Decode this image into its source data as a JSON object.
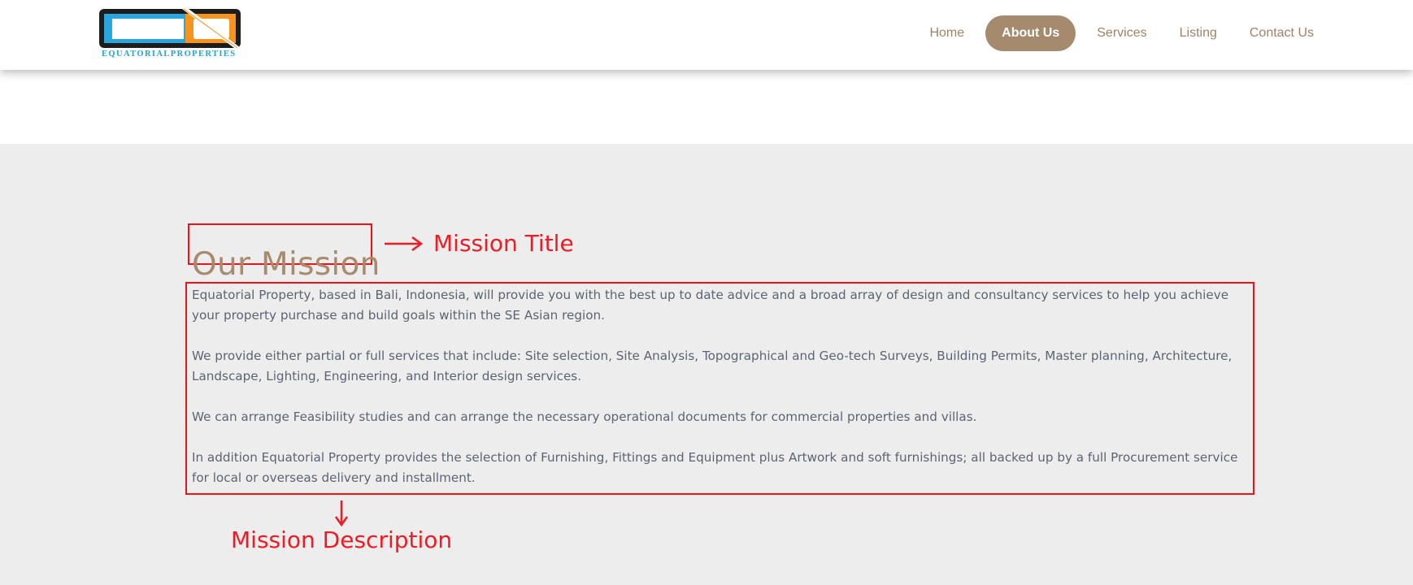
{
  "header": {
    "logo_text": "EQUATORIALPROPERTIES",
    "nav": [
      {
        "label": "Home"
      },
      {
        "label": "About Us"
      },
      {
        "label": "Services"
      },
      {
        "label": "Listing"
      },
      {
        "label": "Contact Us"
      }
    ],
    "active_nav": "About Us"
  },
  "mission": {
    "title": "Our Mission",
    "paragraphs": [
      "Equatorial Property, based in Bali, Indonesia, will provide you with the best up to date advice and a broad array of design and consultancy services to help you achieve your property purchase and build goals within the SE Asian region.",
      "We provide either partial or full services that include: Site selection, Site Analysis, Topographical and Geo-tech Surveys, Building Permits, Master planning, Architecture, Landscape, Lighting, Engineering, and Interior design services.",
      "We can arrange Feasibility studies and can arrange the necessary operational documents for commercial properties and villas.",
      "In addition Equatorial Property provides the selection of Furnishing, Fittings and Equipment plus Artwork and soft furnishings; all backed up by a full Procurement service for local or overseas delivery and installment."
    ]
  },
  "annotations": {
    "title_label": "Mission Title",
    "description_label": "Mission Description"
  },
  "colors": {
    "accent": "#a58a6e",
    "annotation_red": "#ed1c24",
    "band_bg": "#ededed"
  }
}
